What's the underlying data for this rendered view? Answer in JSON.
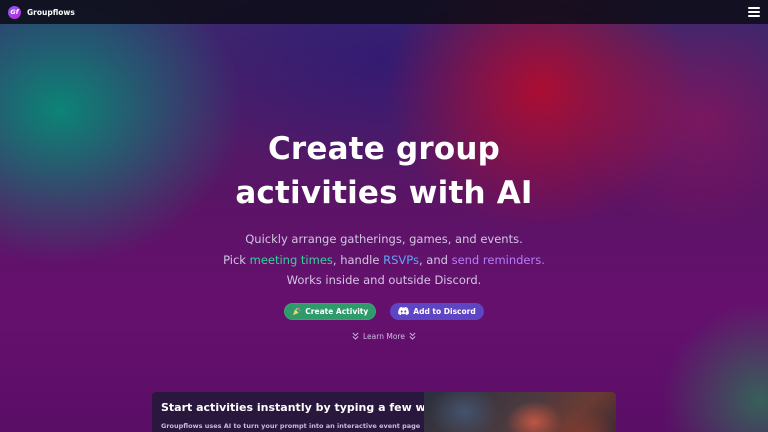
{
  "nav": {
    "logo_text": "Gf",
    "brand": "Groupflows"
  },
  "hero": {
    "headline_line1": "Create group",
    "headline_line2": "activities with AI",
    "line1": "Quickly arrange gatherings, games, and events.",
    "line2_pre": "Pick ",
    "line2_link1": "meeting times",
    "line2_mid1": ", handle ",
    "line2_link2": "RSVPs",
    "line2_mid2": ", and ",
    "line2_link3": "send reminders.",
    "line3": "Works inside and outside Discord.",
    "cta_primary": "Create Activity",
    "cta_secondary": "Add to Discord",
    "learn_more": "Learn More"
  },
  "feature": {
    "title": "Start activities instantly by typing a few words.",
    "description": "Groupflows uses AI to turn your prompt into an interactive event page"
  },
  "colors": {
    "highlight_green": "#34d399",
    "highlight_blue": "#60a5fa",
    "highlight_purple": "#b77cff",
    "cta_green": "#2f9a6a",
    "cta_purple": "#5e45c4"
  },
  "icons": {
    "menu": "hamburger-icon",
    "create": "party-popper-icon",
    "discord": "discord-icon",
    "learn_more": "chevrons-down-icon"
  }
}
